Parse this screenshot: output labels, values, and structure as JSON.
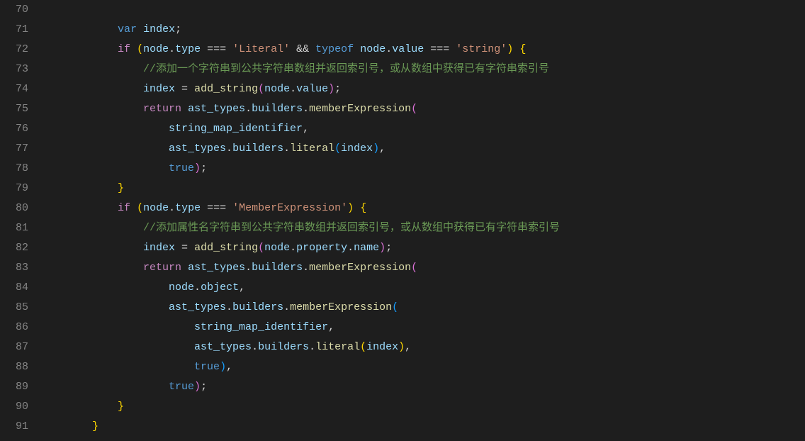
{
  "lines": [
    {
      "num": "70",
      "tokens": []
    },
    {
      "num": "71",
      "tokens": [
        {
          "class": "",
          "text": "            "
        },
        {
          "class": "kw",
          "text": "var"
        },
        {
          "class": "",
          "text": " "
        },
        {
          "class": "var",
          "text": "index"
        },
        {
          "class": "",
          "text": ";"
        }
      ]
    },
    {
      "num": "72",
      "tokens": [
        {
          "class": "",
          "text": "            "
        },
        {
          "class": "kw2",
          "text": "if"
        },
        {
          "class": "",
          "text": " "
        },
        {
          "class": "paren1",
          "text": "("
        },
        {
          "class": "var",
          "text": "node"
        },
        {
          "class": "",
          "text": "."
        },
        {
          "class": "var",
          "text": "type"
        },
        {
          "class": "",
          "text": " === "
        },
        {
          "class": "str",
          "text": "'Literal'"
        },
        {
          "class": "",
          "text": " && "
        },
        {
          "class": "kw",
          "text": "typeof"
        },
        {
          "class": "",
          "text": " "
        },
        {
          "class": "var",
          "text": "node"
        },
        {
          "class": "",
          "text": "."
        },
        {
          "class": "var",
          "text": "value"
        },
        {
          "class": "",
          "text": " === "
        },
        {
          "class": "str",
          "text": "'string'"
        },
        {
          "class": "paren1",
          "text": ")"
        },
        {
          "class": "",
          "text": " "
        },
        {
          "class": "paren1",
          "text": "{"
        }
      ]
    },
    {
      "num": "73",
      "tokens": [
        {
          "class": "",
          "text": "                "
        },
        {
          "class": "comment",
          "text": "//添加一个字符串到公共字符串数组并返回索引号，或从数组中获得已有字符串索引号"
        }
      ]
    },
    {
      "num": "74",
      "tokens": [
        {
          "class": "",
          "text": "                "
        },
        {
          "class": "var",
          "text": "index"
        },
        {
          "class": "",
          "text": " = "
        },
        {
          "class": "fn",
          "text": "add_string"
        },
        {
          "class": "paren2",
          "text": "("
        },
        {
          "class": "var",
          "text": "node"
        },
        {
          "class": "",
          "text": "."
        },
        {
          "class": "var",
          "text": "value"
        },
        {
          "class": "paren2",
          "text": ")"
        },
        {
          "class": "",
          "text": ";"
        }
      ]
    },
    {
      "num": "75",
      "tokens": [
        {
          "class": "",
          "text": "                "
        },
        {
          "class": "kw2",
          "text": "return"
        },
        {
          "class": "",
          "text": " "
        },
        {
          "class": "var",
          "text": "ast_types"
        },
        {
          "class": "",
          "text": "."
        },
        {
          "class": "var",
          "text": "builders"
        },
        {
          "class": "",
          "text": "."
        },
        {
          "class": "fn",
          "text": "memberExpression"
        },
        {
          "class": "paren2",
          "text": "("
        }
      ]
    },
    {
      "num": "76",
      "tokens": [
        {
          "class": "",
          "text": "                    "
        },
        {
          "class": "var",
          "text": "string_map_identifier"
        },
        {
          "class": "",
          "text": ","
        }
      ]
    },
    {
      "num": "77",
      "tokens": [
        {
          "class": "",
          "text": "                    "
        },
        {
          "class": "var",
          "text": "ast_types"
        },
        {
          "class": "",
          "text": "."
        },
        {
          "class": "var",
          "text": "builders"
        },
        {
          "class": "",
          "text": "."
        },
        {
          "class": "fn",
          "text": "literal"
        },
        {
          "class": "paren3",
          "text": "("
        },
        {
          "class": "var",
          "text": "index"
        },
        {
          "class": "paren3",
          "text": ")"
        },
        {
          "class": "",
          "text": ","
        }
      ]
    },
    {
      "num": "78",
      "tokens": [
        {
          "class": "",
          "text": "                    "
        },
        {
          "class": "const",
          "text": "true"
        },
        {
          "class": "paren2",
          "text": ")"
        },
        {
          "class": "",
          "text": ";"
        }
      ]
    },
    {
      "num": "79",
      "tokens": [
        {
          "class": "",
          "text": "            "
        },
        {
          "class": "paren1",
          "text": "}"
        }
      ]
    },
    {
      "num": "80",
      "tokens": [
        {
          "class": "",
          "text": "            "
        },
        {
          "class": "kw2",
          "text": "if"
        },
        {
          "class": "",
          "text": " "
        },
        {
          "class": "paren1",
          "text": "("
        },
        {
          "class": "var",
          "text": "node"
        },
        {
          "class": "",
          "text": "."
        },
        {
          "class": "var",
          "text": "type"
        },
        {
          "class": "",
          "text": " === "
        },
        {
          "class": "str",
          "text": "'MemberExpression'"
        },
        {
          "class": "paren1",
          "text": ")"
        },
        {
          "class": "",
          "text": " "
        },
        {
          "class": "paren1",
          "text": "{"
        }
      ]
    },
    {
      "num": "81",
      "tokens": [
        {
          "class": "",
          "text": "                "
        },
        {
          "class": "comment",
          "text": "//添加属性名字符串到公共字符串数组并返回索引号，或从数组中获得已有字符串索引号"
        }
      ]
    },
    {
      "num": "82",
      "tokens": [
        {
          "class": "",
          "text": "                "
        },
        {
          "class": "var",
          "text": "index"
        },
        {
          "class": "",
          "text": " = "
        },
        {
          "class": "fn",
          "text": "add_string"
        },
        {
          "class": "paren2",
          "text": "("
        },
        {
          "class": "var",
          "text": "node"
        },
        {
          "class": "",
          "text": "."
        },
        {
          "class": "var",
          "text": "property"
        },
        {
          "class": "",
          "text": "."
        },
        {
          "class": "var",
          "text": "name"
        },
        {
          "class": "paren2",
          "text": ")"
        },
        {
          "class": "",
          "text": ";"
        }
      ]
    },
    {
      "num": "83",
      "tokens": [
        {
          "class": "",
          "text": "                "
        },
        {
          "class": "kw2",
          "text": "return"
        },
        {
          "class": "",
          "text": " "
        },
        {
          "class": "var",
          "text": "ast_types"
        },
        {
          "class": "",
          "text": "."
        },
        {
          "class": "var",
          "text": "builders"
        },
        {
          "class": "",
          "text": "."
        },
        {
          "class": "fn",
          "text": "memberExpression"
        },
        {
          "class": "paren2",
          "text": "("
        }
      ]
    },
    {
      "num": "84",
      "tokens": [
        {
          "class": "",
          "text": "                    "
        },
        {
          "class": "var",
          "text": "node"
        },
        {
          "class": "",
          "text": "."
        },
        {
          "class": "var",
          "text": "object"
        },
        {
          "class": "",
          "text": ","
        }
      ]
    },
    {
      "num": "85",
      "tokens": [
        {
          "class": "",
          "text": "                    "
        },
        {
          "class": "var",
          "text": "ast_types"
        },
        {
          "class": "",
          "text": "."
        },
        {
          "class": "var",
          "text": "builders"
        },
        {
          "class": "",
          "text": "."
        },
        {
          "class": "fn",
          "text": "memberExpression"
        },
        {
          "class": "paren3",
          "text": "("
        }
      ]
    },
    {
      "num": "86",
      "tokens": [
        {
          "class": "",
          "text": "                        "
        },
        {
          "class": "var",
          "text": "string_map_identifier"
        },
        {
          "class": "",
          "text": ","
        }
      ]
    },
    {
      "num": "87",
      "tokens": [
        {
          "class": "",
          "text": "                        "
        },
        {
          "class": "var",
          "text": "ast_types"
        },
        {
          "class": "",
          "text": "."
        },
        {
          "class": "var",
          "text": "builders"
        },
        {
          "class": "",
          "text": "."
        },
        {
          "class": "fn",
          "text": "literal"
        },
        {
          "class": "paren1",
          "text": "("
        },
        {
          "class": "var",
          "text": "index"
        },
        {
          "class": "paren1",
          "text": ")"
        },
        {
          "class": "",
          "text": ","
        }
      ]
    },
    {
      "num": "88",
      "tokens": [
        {
          "class": "",
          "text": "                        "
        },
        {
          "class": "const",
          "text": "true"
        },
        {
          "class": "paren3",
          "text": ")"
        },
        {
          "class": "",
          "text": ","
        }
      ]
    },
    {
      "num": "89",
      "tokens": [
        {
          "class": "",
          "text": "                    "
        },
        {
          "class": "const",
          "text": "true"
        },
        {
          "class": "paren2",
          "text": ")"
        },
        {
          "class": "",
          "text": ";"
        }
      ]
    },
    {
      "num": "90",
      "tokens": [
        {
          "class": "",
          "text": "            "
        },
        {
          "class": "paren1",
          "text": "}"
        }
      ]
    },
    {
      "num": "91",
      "tokens": [
        {
          "class": "",
          "text": "        "
        },
        {
          "class": "paren1",
          "text": "}"
        }
      ]
    }
  ]
}
